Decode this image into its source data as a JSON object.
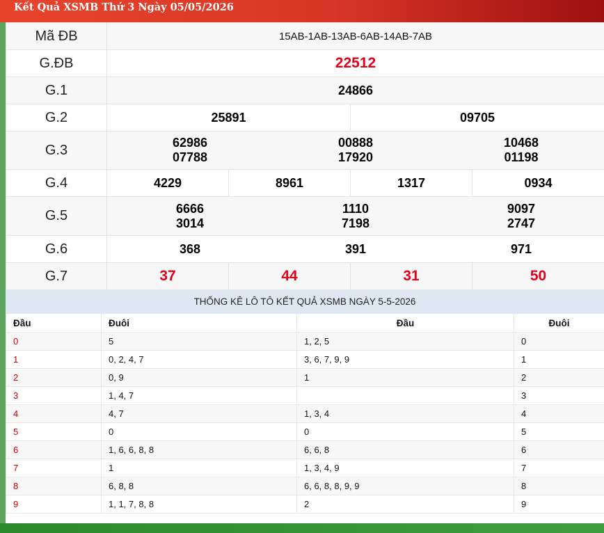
{
  "header": {
    "title": "Kết Quả XSMB Thứ 3 Ngày 05/05/2026"
  },
  "results": {
    "ma_db": {
      "label": "Mã ĐB",
      "value": "15AB-1AB-13AB-6AB-14AB-7AB"
    },
    "gdb": {
      "label": "G.ĐB",
      "numbers": [
        "22512"
      ]
    },
    "g1": {
      "label": "G.1",
      "numbers": [
        "24866"
      ]
    },
    "g2": {
      "label": "G.2",
      "numbers": [
        "25891",
        "09705"
      ]
    },
    "g3": {
      "label": "G.3",
      "numbers": [
        "62986",
        "07788",
        "00888",
        "17920",
        "10468",
        "01198"
      ]
    },
    "g4": {
      "label": "G.4",
      "numbers": [
        "4229",
        "8961",
        "1317",
        "0934"
      ]
    },
    "g5": {
      "label": "G.5",
      "numbers": [
        "6666",
        "3014",
        "1110",
        "7198",
        "9097",
        "2747"
      ]
    },
    "g6": {
      "label": "G.6",
      "numbers": [
        "368",
        "391",
        "971"
      ]
    },
    "g7": {
      "label": "G.7",
      "numbers": [
        "37",
        "44",
        "31",
        "50"
      ]
    }
  },
  "loto": {
    "title": "THỐNG KÊ LÔ TÔ KẾT QUẢ XSMB NGÀY 5-5-2026",
    "headers": [
      "Đầu",
      "Đuôi",
      "Đầu",
      "Đuôi"
    ],
    "rows": [
      [
        "0",
        "5",
        "1, 2, 5",
        "0"
      ],
      [
        "1",
        "0, 2, 4, 7",
        "3, 6, 7, 9, 9",
        "1"
      ],
      [
        "2",
        "0, 9",
        "1",
        "2"
      ],
      [
        "3",
        "1, 4, 7",
        "",
        "3"
      ],
      [
        "4",
        "4, 7",
        "1, 3, 4",
        "4"
      ],
      [
        "5",
        "0",
        "0",
        "5"
      ],
      [
        "6",
        "1, 6, 6, 8, 8",
        "6, 6, 8",
        "6"
      ],
      [
        "7",
        "1",
        "1, 3, 4, 9",
        "7"
      ],
      [
        "8",
        "6, 8, 8",
        "6, 6, 8, 8, 9, 9",
        "8"
      ],
      [
        "9",
        "1, 1, 7, 8, 8",
        "2",
        "9"
      ]
    ]
  },
  "colors": {
    "accent_red": "#e3001b",
    "header_red": "#d83626",
    "stat_bg": "#dde8f2",
    "side_green": "#5da35d"
  }
}
